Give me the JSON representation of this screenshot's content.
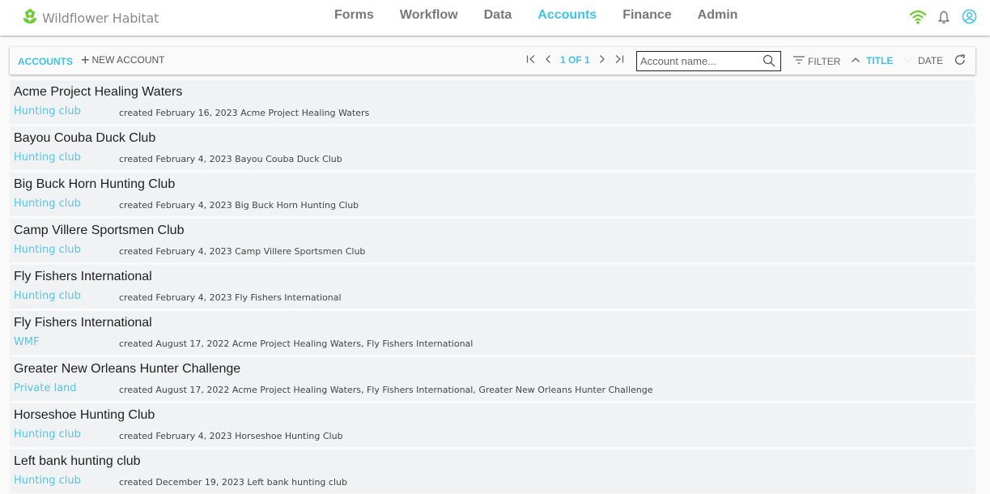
{
  "app": {
    "title": "Wildflower Habitat",
    "logo_icon": "flower-icon",
    "brand_color": "#6ccb2f",
    "accent_color": "#3fc3e6"
  },
  "nav": {
    "items": [
      {
        "label": "Forms",
        "active": false
      },
      {
        "label": "Workflow",
        "active": false
      },
      {
        "label": "Data",
        "active": false
      },
      {
        "label": "Accounts",
        "active": true
      },
      {
        "label": "Finance",
        "active": false
      },
      {
        "label": "Admin",
        "active": false
      }
    ]
  },
  "top_icons": [
    "wifi-icon",
    "bell-icon",
    "user-account-icon"
  ],
  "toolbar": {
    "section_label": "ACCOUNTS",
    "new_label": "NEW ACCOUNT",
    "pager": {
      "text": "1 OF 1",
      "first_icon": "first-page-icon",
      "prev_icon": "prev-page-icon",
      "next_icon": "next-page-icon",
      "last_icon": "last-page-icon"
    },
    "search": {
      "value": "",
      "placeholder": "Account name..."
    },
    "filter_label": "FILTER",
    "sort_title_label": "TITLE",
    "sort_date_label": "DATE",
    "refresh_icon": "refresh-icon"
  },
  "accounts": [
    {
      "name": "Acme Project Healing Waters",
      "type": "Hunting club",
      "meta": "created February 16, 2023 Acme Project Healing Waters"
    },
    {
      "name": "Bayou Couba Duck Club",
      "type": "Hunting club",
      "meta": "created February 4, 2023 Bayou Couba Duck Club"
    },
    {
      "name": "Big Buck Horn Hunting Club",
      "type": "Hunting club",
      "meta": "created February 4, 2023 Big Buck Horn Hunting Club"
    },
    {
      "name": "Camp Villere Sportsmen Club",
      "type": "Hunting club",
      "meta": "created February 4, 2023 Camp Villere Sportsmen Club"
    },
    {
      "name": "Fly Fishers International",
      "type": "Hunting club",
      "meta": "created February 4, 2023 Fly Fishers International"
    },
    {
      "name": "Fly Fishers International",
      "type": "WMF",
      "meta": "created August 17, 2022 Acme Project Healing Waters, Fly Fishers International"
    },
    {
      "name": "Greater New Orleans Hunter Challenge",
      "type": "Private land",
      "meta": "created August 17, 2022 Acme Project Healing Waters, Fly Fishers International, Greater New Orleans Hunter Challenge"
    },
    {
      "name": "Horseshoe Hunting Club",
      "type": "Hunting club",
      "meta": "created February 4, 2023 Horseshoe Hunting Club"
    },
    {
      "name": "Left bank hunting club",
      "type": "Hunting club",
      "meta": "created December 19, 2023 Left bank hunting club"
    }
  ]
}
